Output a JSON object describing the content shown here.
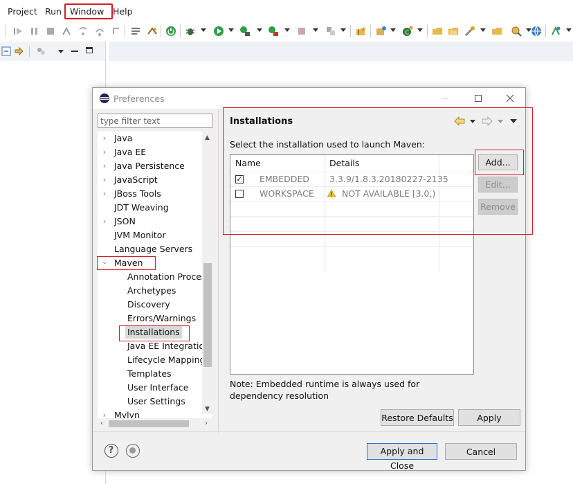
{
  "menubar": {
    "items": [
      "Project",
      "Run",
      "Window",
      "Help"
    ]
  },
  "dialog": {
    "title": "Preferences",
    "filter_placeholder": "type filter text",
    "tree": [
      {
        "label": "Java",
        "expandable": true
      },
      {
        "label": "Java EE",
        "expandable": true
      },
      {
        "label": "Java Persistence",
        "expandable": true
      },
      {
        "label": "JavaScript",
        "expandable": true
      },
      {
        "label": "JBoss Tools",
        "expandable": true
      },
      {
        "label": "JDT Weaving",
        "expandable": false
      },
      {
        "label": "JSON",
        "expandable": true
      },
      {
        "label": "JVM Monitor",
        "expandable": false
      },
      {
        "label": "Language Servers",
        "expandable": false
      },
      {
        "label": "Maven",
        "expandable": true,
        "expanded": true
      },
      {
        "label": "Annotation Processing",
        "child": true
      },
      {
        "label": "Archetypes",
        "child": true
      },
      {
        "label": "Discovery",
        "child": true
      },
      {
        "label": "Errors/Warnings",
        "child": true
      },
      {
        "label": "Installations",
        "child": true,
        "selected": true
      },
      {
        "label": "Java EE Integration",
        "child": true
      },
      {
        "label": "Lifecycle Mappings",
        "child": true
      },
      {
        "label": "Templates",
        "child": true
      },
      {
        "label": "User Interface",
        "child": true
      },
      {
        "label": "User Settings",
        "child": true
      },
      {
        "label": "Mylyn",
        "expandable": true
      }
    ],
    "page": {
      "title": "Installations",
      "description": "Select the installation used to launch Maven:",
      "columns": [
        "Name",
        "Details"
      ],
      "rows": [
        {
          "checked": true,
          "name": "EMBEDDED",
          "details": "3.3.9/1.8.3.20180227-2135",
          "warning": false
        },
        {
          "checked": false,
          "name": "WORKSPACE",
          "details": "NOT AVAILABLE [3.0,)",
          "warning": true
        }
      ],
      "buttons": {
        "add": "Add...",
        "edit": "Edit...",
        "remove": "Remove"
      },
      "note": "Note: Embedded runtime is always used for dependency resolution",
      "restore_defaults": "Restore Defaults",
      "apply": "Apply"
    },
    "footer": {
      "apply_and_close": "Apply and Close",
      "cancel": "Cancel"
    }
  },
  "colors": {
    "highlight_red": "#d01e2a",
    "selection_bg": "#d9d9d9",
    "default_button_border": "#2a6fd6"
  }
}
